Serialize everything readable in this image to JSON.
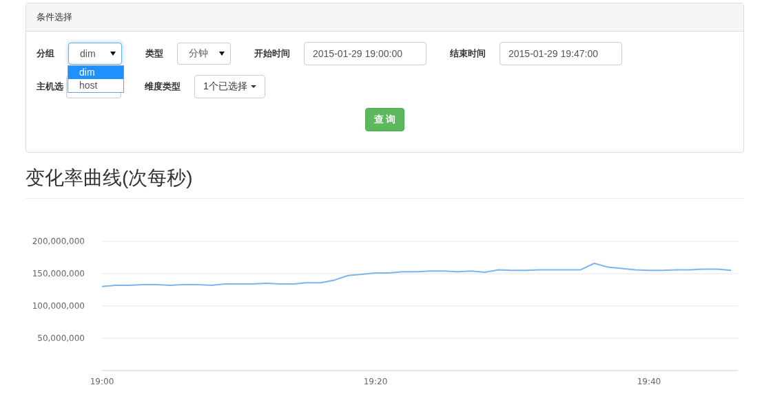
{
  "panel": {
    "title": "条件选择",
    "rows": [
      [
        {
          "kind": "select",
          "label": "分组",
          "value": "dim",
          "open": true,
          "options": [
            {
              "label": "dim",
              "selected": true
            },
            {
              "label": "host",
              "selected": false
            }
          ]
        },
        {
          "kind": "select",
          "label": "类型",
          "value": "分钟"
        },
        {
          "kind": "input",
          "label": "开始时间",
          "value": "2015-01-29 19:00:00"
        },
        {
          "kind": "input",
          "label": "结束时间",
          "value": "2015-01-29 19:47:00"
        }
      ],
      [
        {
          "kind": "multiselect",
          "label": "主机选"
        },
        {
          "kind": "multiselect",
          "label": "维度类型",
          "value": "1个已选择"
        }
      ]
    ],
    "button": {
      "label": "查 询"
    }
  },
  "heading": "变化率曲线(次每秒)",
  "chart_data": {
    "type": "line",
    "categories": [
      "19:00",
      null,
      null,
      null,
      null,
      null,
      null,
      null,
      null,
      null,
      null,
      null,
      null,
      null,
      null,
      null,
      null,
      null,
      null,
      null,
      "19:20",
      null,
      null,
      null,
      null,
      null,
      null,
      null,
      null,
      null,
      null,
      null,
      null,
      null,
      null,
      null,
      null,
      null,
      null,
      null,
      "19:40",
      null,
      null,
      null,
      null,
      null,
      null
    ],
    "series": [
      {
        "color": "#7cb5ec",
        "values": [
          130000000,
          132000000,
          132000000,
          133000000,
          133000000,
          132000000,
          133000000,
          133000000,
          132000000,
          134000000,
          134000000,
          134000000,
          135000000,
          134000000,
          134000000,
          136000000,
          136000000,
          140000000,
          147000000,
          149000000,
          151000000,
          151000000,
          153000000,
          153000000,
          154000000,
          154000000,
          153000000,
          154000000,
          152000000,
          156000000,
          155000000,
          155000000,
          156000000,
          156000000,
          156000000,
          156000000,
          166000000,
          160000000,
          158000000,
          156000000,
          155000000,
          155000000,
          156000000,
          156000000,
          157000000,
          157000000,
          155000000
        ]
      }
    ],
    "ylim": [
      0,
      200000000
    ],
    "grid": true,
    "yticks": [
      {
        "value": 50000000,
        "label": "50,000,000"
      },
      {
        "value": 100000000,
        "label": "100,000,000"
      },
      {
        "value": 150000000,
        "label": "150,000,000"
      },
      {
        "value": 200000000,
        "label": "200,000,000"
      }
    ]
  }
}
